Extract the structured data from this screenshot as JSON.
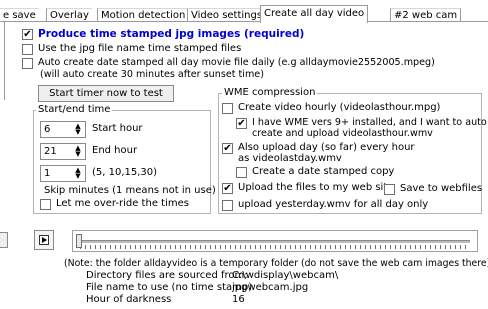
{
  "tabs": [
    {
      "label": "e save"
    },
    {
      "label": "Overlay"
    },
    {
      "label": "Motion detection"
    },
    {
      "label": "Video settings"
    },
    {
      "label": "Create all day video",
      "active": true
    },
    {
      "label": "#2 web cam"
    }
  ],
  "main": {
    "produce_label": "Produce time stamped jpg images (required)",
    "produce_checked": true,
    "use_jpg_label": "Use the jpg file name time stamped files",
    "use_jpg_checked": false,
    "auto_create_label": "Auto create date stamped all day movie file daily (e.g alldaymovie2552005.mpeg)",
    "auto_create_checked": false,
    "auto_create_note": "(will auto create 30 minutes after sunset time)",
    "start_button": "Start timer now to test"
  },
  "start_end": {
    "title": "Start/end time",
    "start_value": "6",
    "start_label": "Start hour",
    "end_value": "21",
    "end_label": "End hour",
    "skip_value": "1",
    "skip_hint": "(5, 10,15,30)",
    "skip_label": "Skip minutes (1 means not in use)",
    "override_label": "Let me over-ride the times",
    "override_checked": false
  },
  "wme": {
    "title": "WME compression",
    "hourly_label": "Create video hourly (videolasthour.mpg)",
    "hourly_checked": false,
    "wme9_label_1": "I have WME vers 9+ installed, and I want to auto",
    "wme9_label_2": "create and upload videolasthour.wmv",
    "wme9_checked": true,
    "upload_day_label_1": "Also upload day (so far) every hour",
    "upload_day_label_2": "as videolastday.wmv",
    "upload_day_checked": true,
    "date_copy_label": "Create a date stamped copy",
    "date_copy_checked": false,
    "upload_files_label": "Upload the files to my web site",
    "upload_files_checked": true,
    "save_webfiles_label": "Save to webfiles",
    "save_webfiles_checked": false,
    "yesterday_label": "upload yesterday.wmv for all day only",
    "yesterday_checked": false
  },
  "player": {
    "play_icon": "play-icon",
    "slider_position": 0
  },
  "info": {
    "note": "(Note: the folder alldayvideo is a temporary folder (do not save the  web cam images there)",
    "dir_label": "Directory files are sourced from:",
    "dir_value": "C:\\wdisplay\\webcam\\",
    "file_label": "File name to use (no time stamp)",
    "file_value": "jpgwebcam.jpg",
    "dark_label": "Hour of darkness",
    "dark_value": "16"
  }
}
